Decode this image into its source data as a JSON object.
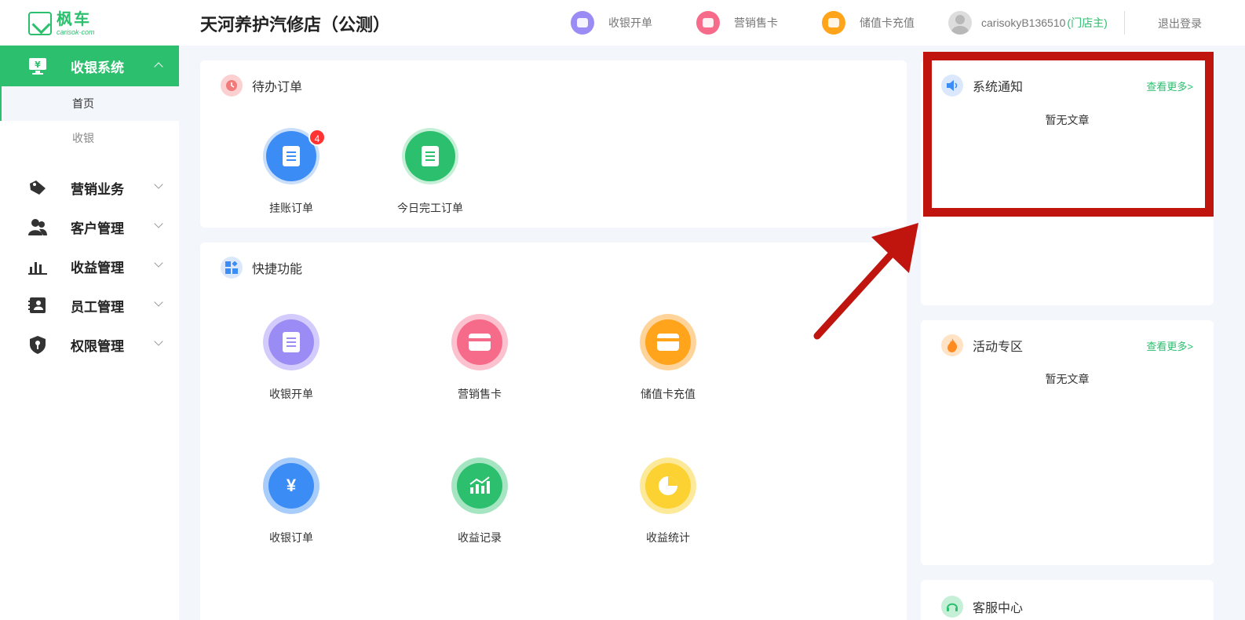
{
  "header": {
    "logo_text": "枫车",
    "logo_sub": "carisok·com",
    "store_title": "天河养护汽修店（公测）",
    "actions": [
      {
        "label": "收银开单",
        "color": "#9b8cf5",
        "icon": "cashier-icon"
      },
      {
        "label": "营销售卡",
        "color": "#f76b8a",
        "icon": "card-icon"
      },
      {
        "label": "储值卡充值",
        "color": "#ffa41b",
        "icon": "wallet-icon"
      }
    ],
    "username": "carisokyB136510",
    "user_role": "(门店主)",
    "logout": "退出登录"
  },
  "sidebar": {
    "groups": [
      {
        "label": "收银系统",
        "icon": "monitor-yen-icon",
        "expanded": true,
        "children": [
          {
            "label": "首页",
            "current": true
          },
          {
            "label": "收银",
            "current": false
          }
        ]
      },
      {
        "label": "营销业务",
        "icon": "tag-icon"
      },
      {
        "label": "客户管理",
        "icon": "users-icon"
      },
      {
        "label": "收益管理",
        "icon": "bar-chart-icon"
      },
      {
        "label": "员工管理",
        "icon": "id-card-icon"
      },
      {
        "label": "权限管理",
        "icon": "shield-icon"
      }
    ]
  },
  "pending": {
    "title": "待办订单",
    "items": [
      {
        "label": "挂账订单",
        "badge": "4",
        "color": "#3b8cf5"
      },
      {
        "label": "今日完工订单",
        "color": "#2cbf6e"
      }
    ]
  },
  "quick": {
    "title": "快捷功能",
    "items": [
      {
        "label": "收银开单",
        "color": "#9b8cf5",
        "ring": "#d3cbfb"
      },
      {
        "label": "营销售卡",
        "color": "#f76b8a",
        "ring": "#fcc1ce"
      },
      {
        "label": "储值卡充值",
        "color": "#ffa41b",
        "ring": "#ffd49a"
      },
      {
        "label": "收银订单",
        "color": "#3b8cf5",
        "ring": "#a9cdfb",
        "glyph": "¥"
      },
      {
        "label": "收益记录",
        "color": "#2cbf6e",
        "ring": "#a6e5c2"
      },
      {
        "label": "收益统计",
        "color": "#fcd232",
        "ring": "#fde99a"
      }
    ]
  },
  "notice": {
    "title": "系统通知",
    "more": "查看更多>",
    "empty": "暂无文章"
  },
  "activity": {
    "title": "活动专区",
    "more": "查看更多>",
    "empty": "暂无文章"
  },
  "service": {
    "title": "客服中心"
  },
  "colors": {
    "brand": "#2cbf6e",
    "annotation": "#c0140f"
  }
}
